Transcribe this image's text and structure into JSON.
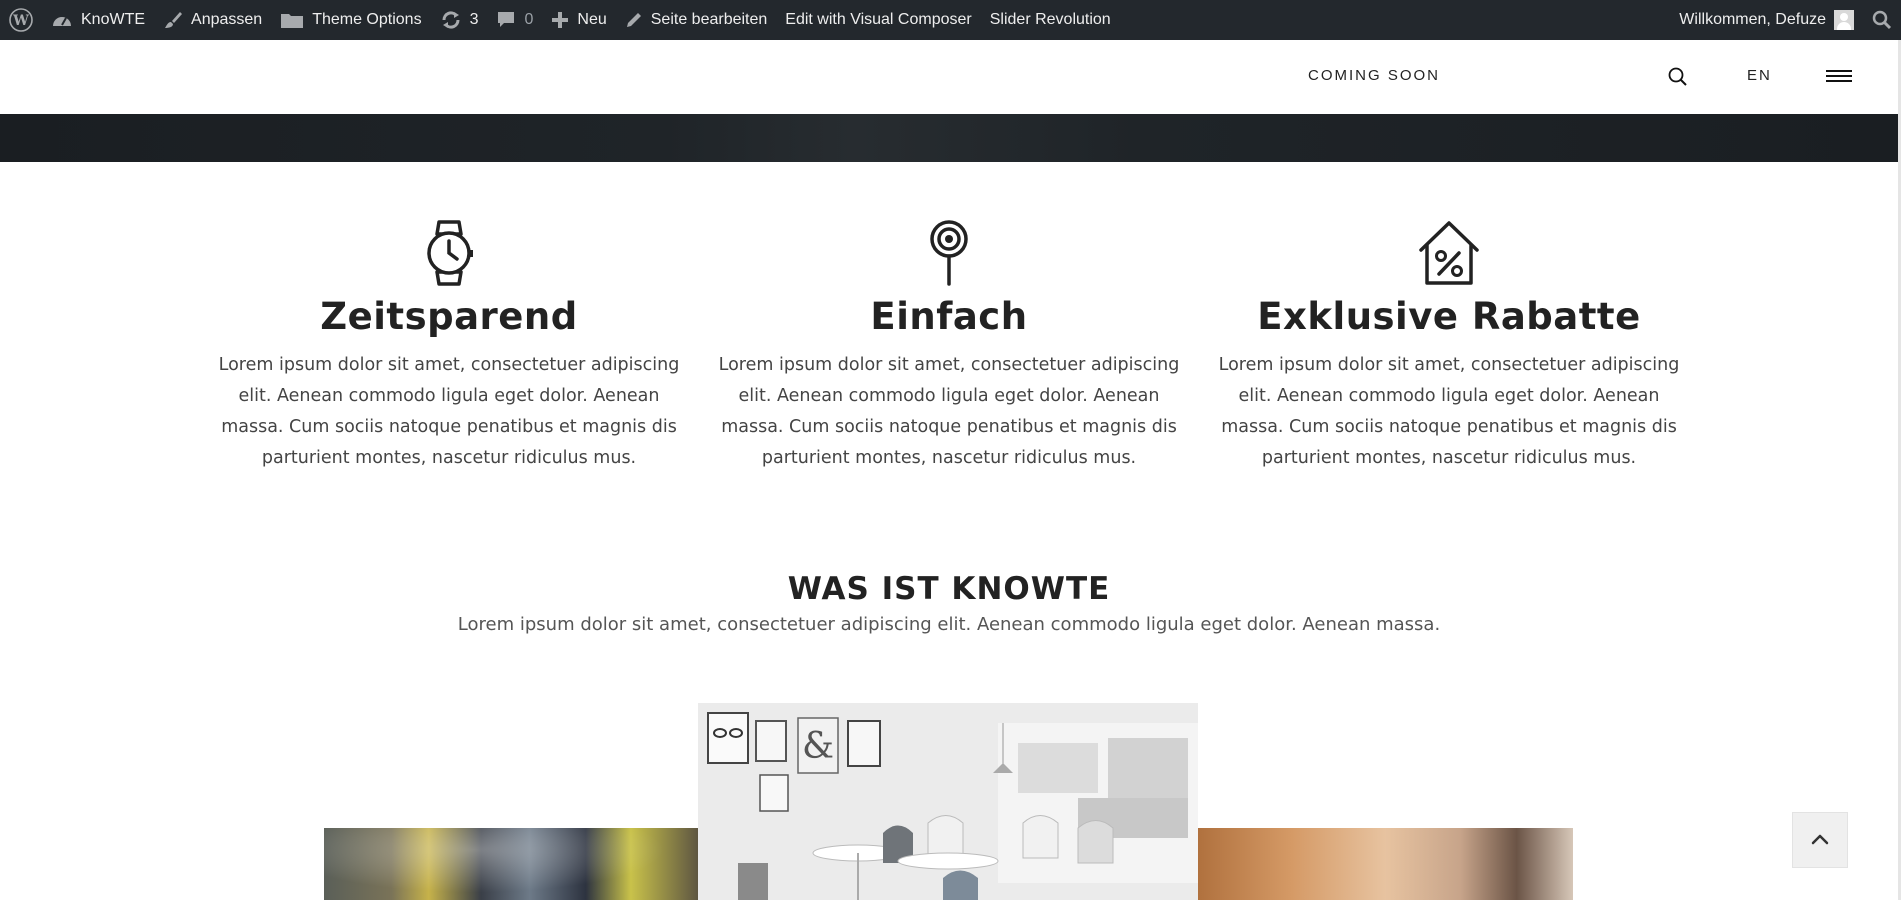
{
  "adminbar": {
    "site_name": "KnoWTE",
    "customize": "Anpassen",
    "theme_options": "Theme Options",
    "updates_count": "3",
    "comments_count": "0",
    "new": "Neu",
    "edit_page": "Seite bearbeiten",
    "visual_composer": "Edit with Visual Composer",
    "slider_revolution": "Slider Revolution",
    "welcome": "Willkommen, Defuze",
    "colors": {
      "background": "#23282d",
      "text": "#eeeeee"
    }
  },
  "header": {
    "coming_soon": "COMING SOON",
    "language": "EN"
  },
  "features": [
    {
      "icon": "watch-icon",
      "title": "Zeitsparend",
      "text": "Lorem ipsum dolor sit amet, consectetuer adipiscing elit. Aenean commodo ligula eget dolor. Aenean massa. Cum sociis natoque penatibus et magnis dis parturient montes, nascetur ridiculus mus."
    },
    {
      "icon": "target-pin-icon",
      "title": "Einfach",
      "text": "Lorem ipsum dolor sit amet, consectetuer adipiscing elit. Aenean commodo ligula eget dolor. Aenean massa. Cum sociis natoque penatibus et magnis dis parturient montes, nascetur ridiculus mus."
    },
    {
      "icon": "house-percent-icon",
      "title": "Exklusive Rabatte",
      "text": "Lorem ipsum dolor sit amet, consectetuer adipiscing elit. Aenean commodo ligula eget dolor. Aenean massa. Cum sociis natoque penatibus et magnis dis parturient montes, nascetur ridiculus mus."
    }
  ],
  "about": {
    "title": "WAS IST KNOWTE",
    "subtitle": "Lorem ipsum dolor sit amet, consectetuer adipiscing elit. Aenean commodo ligula eget dolor. Aenean massa."
  }
}
